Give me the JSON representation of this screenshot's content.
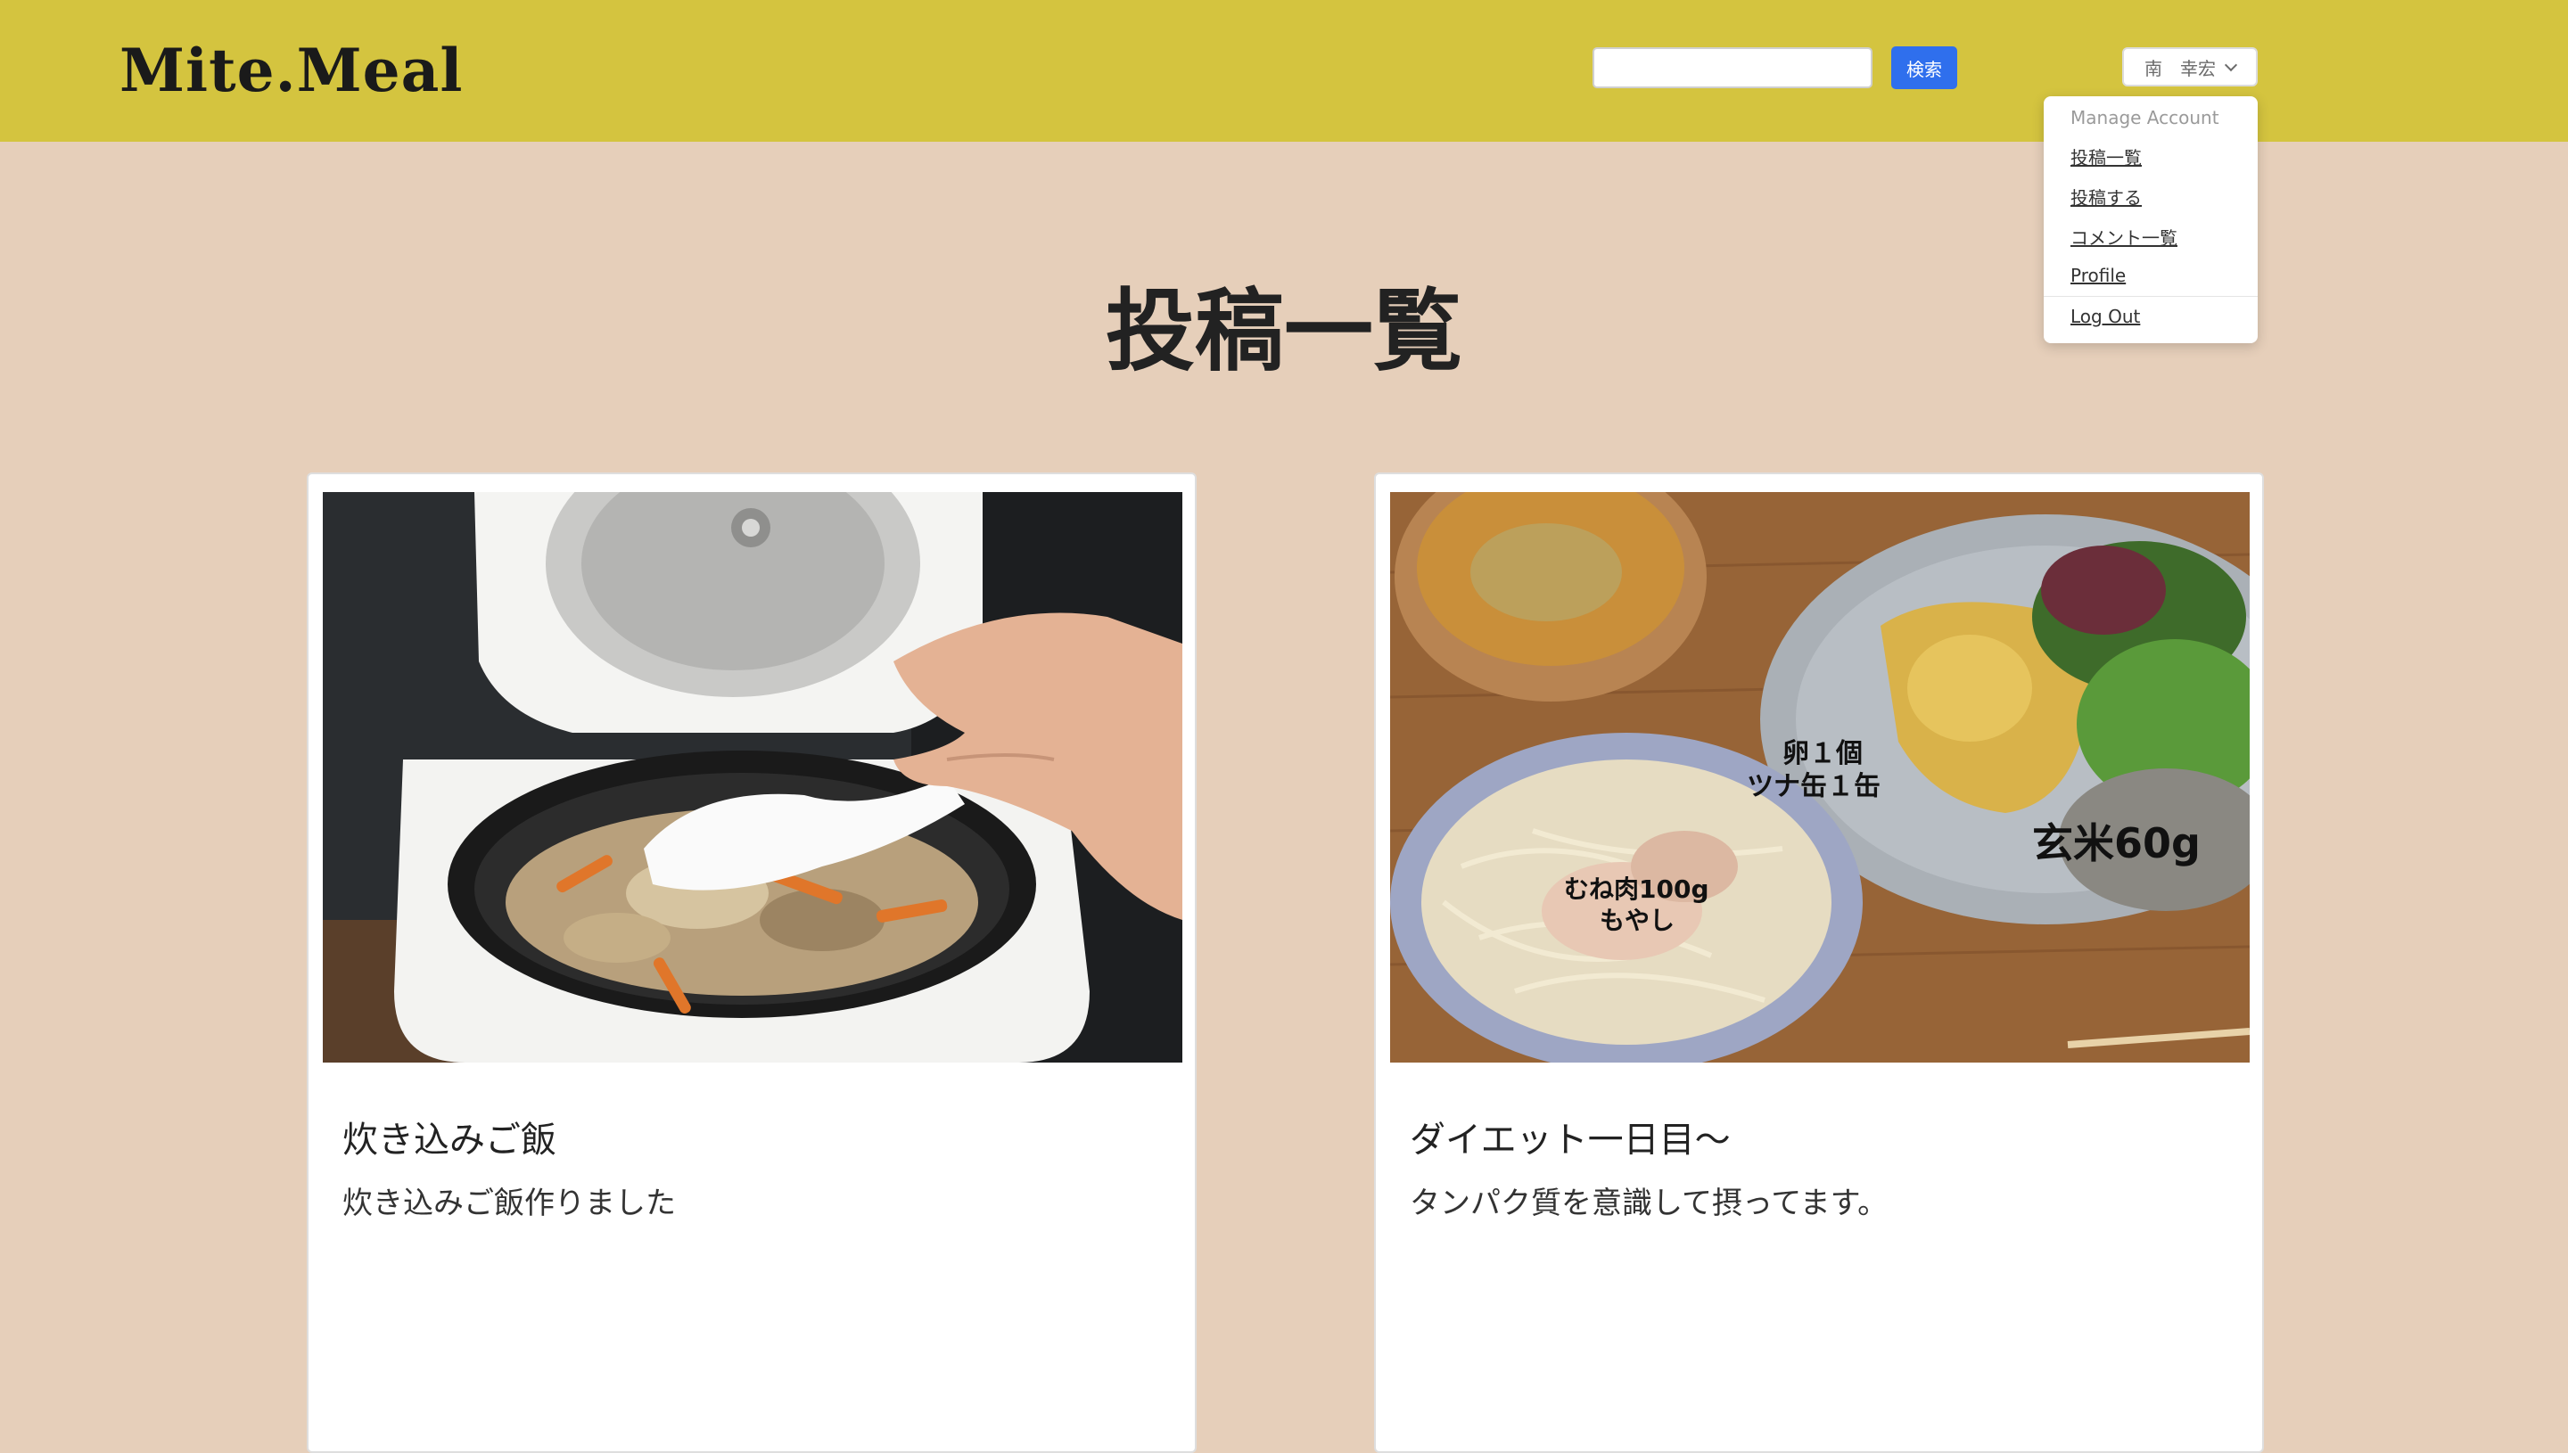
{
  "header": {
    "logo": "Mite.Meal",
    "search": {
      "value": "",
      "placeholder": ""
    },
    "search_button_label": "検索",
    "user_menu_label": "南　幸宏"
  },
  "account_menu": {
    "section_label": "Manage Account",
    "items": [
      {
        "label": "投稿一覧"
      },
      {
        "label": "投稿する"
      },
      {
        "label": "コメント一覧"
      },
      {
        "label": "Profile"
      }
    ],
    "logout_label": "Log Out"
  },
  "main": {
    "page_title": "投稿一覧",
    "posts": [
      {
        "title": "炊き込みご飯",
        "body": "炊き込みご飯作りました",
        "image_overlay": []
      },
      {
        "title": "ダイエット一日目〜",
        "body": "タンパク質を意識して摂ってます。",
        "image_overlay": [
          "卵１個",
          "ツナ缶１缶",
          "玄米60g",
          "むね肉100g",
          "もやし"
        ]
      }
    ]
  },
  "colors": {
    "header_bg": "#d4c43f",
    "page_bg": "#e6cfba",
    "primary_button": "#2f6fed",
    "card_bg": "#ffffff"
  }
}
